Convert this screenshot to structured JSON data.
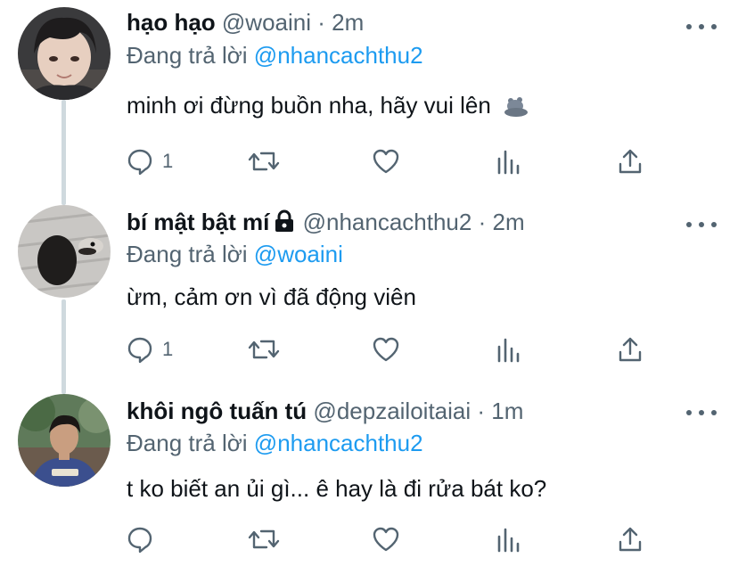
{
  "tweets": [
    {
      "name": "hạo hạo",
      "handle": "@woaini",
      "time": "2m",
      "replying_prefix": "Đang trả lời",
      "replying_to": "@nhancachthu2",
      "text": "minh ơi đừng buồn nha, hãy vui lên",
      "emoji": "bears-emoji",
      "reply_count": "1",
      "has_lock": false
    },
    {
      "name": "bí mật bật mí",
      "handle": "@nhancachthu2",
      "time": "2m",
      "replying_prefix": "Đang trả lời",
      "replying_to": "@woaini",
      "text": "ừm, cảm ơn vì đã động viên",
      "reply_count": "1",
      "has_lock": true
    },
    {
      "name": "khôi ngô tuấn tú",
      "handle": "@depzailoitaiai",
      "time": "1m",
      "replying_prefix": "Đang trả lời",
      "replying_to": "@nhancachthu2",
      "text": "t ko biết an ủi gì... ê hay là đi rửa bát ko?",
      "reply_count": "",
      "has_lock": false
    }
  ],
  "separator": "·",
  "icons": [
    "reply-icon",
    "retweet-icon",
    "like-icon",
    "analytics-icon",
    "share-icon",
    "more-icon",
    "lock-icon"
  ],
  "colors": {
    "accent": "#1d9bf0",
    "muted": "#536471",
    "thread_line": "#cfd9de"
  }
}
